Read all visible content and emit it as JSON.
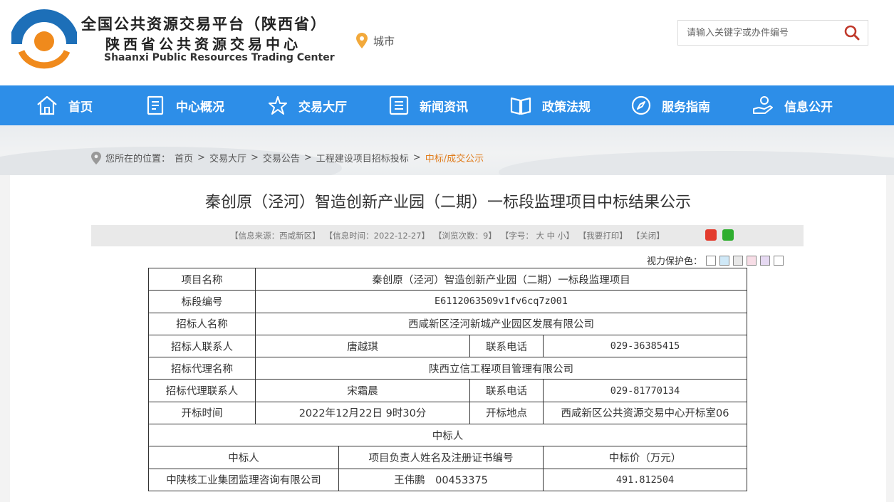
{
  "header": {
    "title_cn_line1": "全国公共资源交易平台（陕西省）",
    "title_cn_line2": "陕西省公共资源交易中心",
    "title_en": "Shaanxi Public Resources Trading Center",
    "city_label": "城市",
    "search_placeholder": "请输入关键字或办件编号"
  },
  "nav": {
    "items": [
      {
        "label": "首页",
        "icon": "home-icon"
      },
      {
        "label": "中心概况",
        "icon": "document-icon"
      },
      {
        "label": "交易大厅",
        "icon": "star-icon"
      },
      {
        "label": "新闻资讯",
        "icon": "news-icon"
      },
      {
        "label": "政策法规",
        "icon": "book-icon"
      },
      {
        "label": "服务指南",
        "icon": "compass-icon"
      },
      {
        "label": "信息公开",
        "icon": "hand-icon"
      }
    ]
  },
  "breadcrumb": {
    "prefix": "您所在的位置：",
    "items": [
      "首页",
      "交易大厅",
      "交易公告",
      "工程建设项目招标投标"
    ],
    "separator": ">",
    "current": "中标/成交公示"
  },
  "article": {
    "title": "秦创原（泾河）智造创新产业园（二期）一标段监理项目中标结果公示",
    "meta": {
      "source": "【信息来源：西咸新区】",
      "time": "【信息时间：2022-12-27】",
      "views": "【浏览次数：9】",
      "font_size_label": "【字号：",
      "font_large": "大",
      "font_medium": "中",
      "font_small": "小",
      "font_size_end": "】",
      "print": "【我要打印】",
      "close": "【关闭】"
    },
    "eye_care_label": "视力保护色：",
    "eye_care_colors": [
      "#ffffff",
      "#cfe8f7",
      "#e8e8e8",
      "#f7dde6",
      "#e6d9f2",
      "#ffffff"
    ]
  },
  "table": {
    "project_name_label": "项目名称",
    "project_name": "秦创原（泾河）智造创新产业园（二期）一标段监理项目",
    "section_no_label": "标段编号",
    "section_no": "E6112063509v1fv6cq7z001",
    "tenderer_label": "招标人名称",
    "tenderer": "西咸新区泾河新城产业园区发展有限公司",
    "tenderer_contact_label": "招标人联系人",
    "tenderer_contact": "唐越琪",
    "phone_label": "联系电话",
    "tenderer_phone": "029-36385415",
    "agency_label": "招标代理名称",
    "agency": "陕西立信工程项目管理有限公司",
    "agency_contact_label": "招标代理联系人",
    "agency_contact": "宋霜晨",
    "agency_phone": "029-81770134",
    "open_time_label": "开标时间",
    "open_time": "2022年12月22日 9时30分",
    "open_place_label": "开标地点",
    "open_place": "西咸新区公共资源交易中心开标室06",
    "winner_section_label": "中标人",
    "winner_col_label": "中标人",
    "manager_col_label": "项目负责人姓名及注册证书编号",
    "price_col_label": "中标价（万元）",
    "winner": "中陕核工业集团监理咨询有限公司",
    "manager": "王伟鹏　00453375",
    "price": "491.812504"
  },
  "colors": {
    "nav_bg": "#2d8ee8",
    "breadcrumb_current": "#e07b1a",
    "logo_blue": "#1d6fb8",
    "logo_orange": "#f08a1c"
  }
}
